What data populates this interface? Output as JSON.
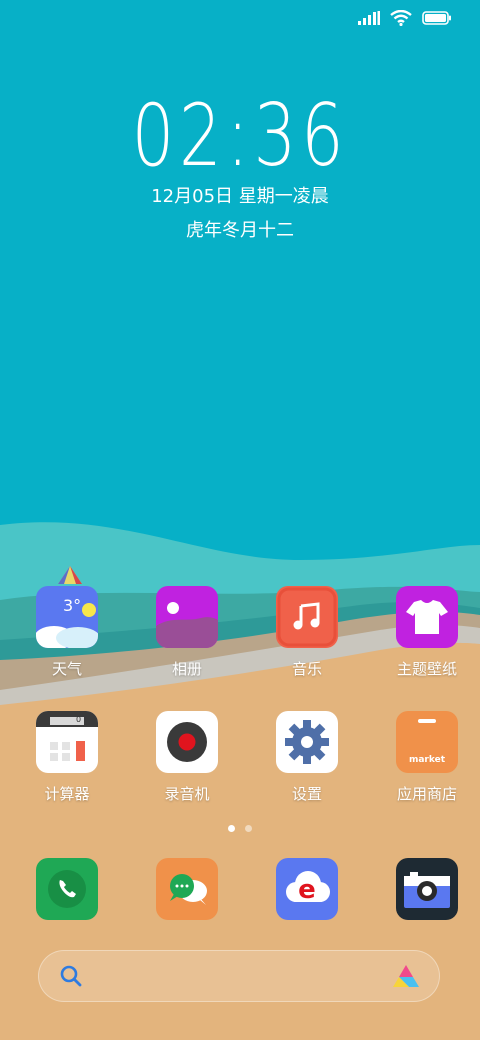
{
  "status_bar": {
    "icons": [
      "signal-icon",
      "wifi-icon",
      "battery-icon"
    ]
  },
  "clock": {
    "time": "02:36",
    "date": "12月05日 星期一凌晨",
    "lunar": "虎年冬月十二"
  },
  "apps_row1": [
    {
      "name": "app-weather",
      "label": "天气",
      "icon": "weather-icon",
      "temp": "3°"
    },
    {
      "name": "app-gallery",
      "label": "相册",
      "icon": "gallery-icon"
    },
    {
      "name": "app-music",
      "label": "音乐",
      "icon": "music-icon"
    },
    {
      "name": "app-themes",
      "label": "主题壁纸",
      "icon": "shirt-icon"
    }
  ],
  "apps_row2": [
    {
      "name": "app-calculator",
      "label": "计算器",
      "icon": "calculator-icon",
      "display": "0"
    },
    {
      "name": "app-recorder",
      "label": "录音机",
      "icon": "record-icon"
    },
    {
      "name": "app-settings",
      "label": "设置",
      "icon": "gear-icon"
    },
    {
      "name": "app-store",
      "label": "应用商店",
      "icon": "market-icon",
      "text": "market"
    }
  ],
  "page_indicator": {
    "pages": 2,
    "current": 1
  },
  "dock": [
    {
      "name": "dock-phone",
      "icon": "phone-icon"
    },
    {
      "name": "dock-messages",
      "icon": "messages-icon"
    },
    {
      "name": "dock-browser",
      "icon": "browser-icon",
      "letter": "e"
    },
    {
      "name": "dock-camera",
      "icon": "camera-icon"
    }
  ],
  "search": {
    "placeholder": "",
    "icons": [
      "search-icon",
      "assistant-icon"
    ]
  },
  "colors": {
    "sky": "#07B0C7",
    "sand": "#E3B47D",
    "weather": "#5A78F0",
    "gallery": "#C022E0",
    "music": "#F0614A",
    "themes": "#C022E0",
    "market": "#F0914A",
    "phone": "#1FA855",
    "messages": "#F0914A",
    "browser": "#5A78F0",
    "camera": "#1E2A33"
  }
}
